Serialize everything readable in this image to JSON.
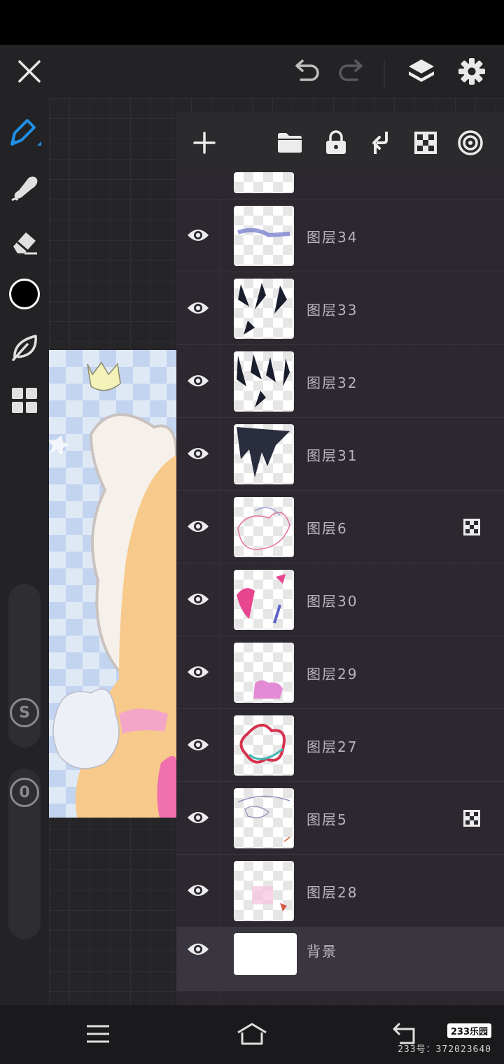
{
  "toolbar": {
    "close_icon": "close-icon",
    "undo_icon": "undo-icon",
    "redo_icon": "redo-icon",
    "layers_icon": "layers-icon",
    "settings_icon": "gear-icon"
  },
  "left_toolbar": {
    "tools": [
      "pen-icon",
      "blur-icon",
      "eraser-icon",
      "color-swatch",
      "leaf-icon",
      "grid-icon"
    ],
    "current_color": "#000000",
    "size_slider_label": "S",
    "opacity_slider_label": "0"
  },
  "layers_panel": {
    "actions": [
      "add-icon",
      "folder-icon",
      "lock-icon",
      "merge-down-icon",
      "checker-icon",
      "target-icon"
    ],
    "layers": [
      {
        "name": "图层34",
        "clipped": false
      },
      {
        "name": "图层33",
        "clipped": false
      },
      {
        "name": "图层32",
        "clipped": false
      },
      {
        "name": "图层31",
        "clipped": false
      },
      {
        "name": "图层6",
        "clipped": true
      },
      {
        "name": "图层30",
        "clipped": false
      },
      {
        "name": "图层29",
        "clipped": false
      },
      {
        "name": "图层27",
        "clipped": false
      },
      {
        "name": "图层5",
        "clipped": true
      },
      {
        "name": "图层28",
        "clipped": false
      },
      {
        "name": "背景",
        "clipped": false
      }
    ]
  },
  "nav": {
    "watermark": "233乐园",
    "watermark_sub": "233号：372023640"
  }
}
